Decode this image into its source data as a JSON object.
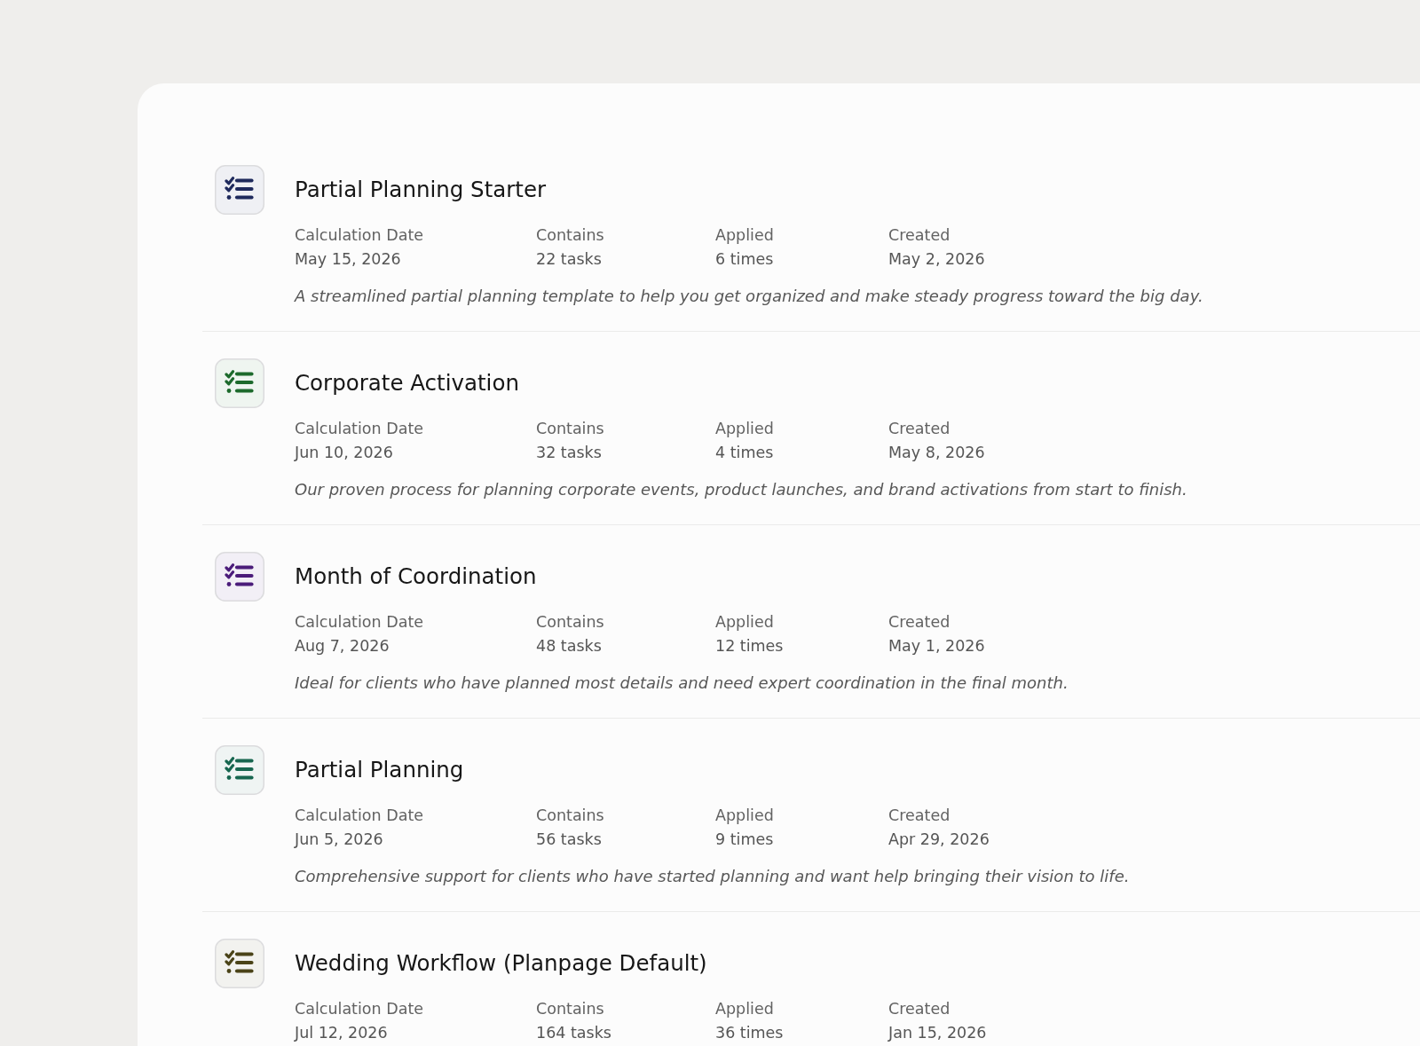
{
  "templates": [
    {
      "title": "Partial Planning Starter",
      "color": "#1f2a5c",
      "fields": [
        {
          "label": "Calculation Date",
          "value": "May 15, 2026"
        },
        {
          "label": "Contains",
          "value": "22 tasks"
        },
        {
          "label": "Applied",
          "value": "6 times"
        },
        {
          "label": "Created",
          "value": "May 2, 2026"
        }
      ],
      "description": "A streamlined partial planning template to help you get organized and make steady progress toward the big day."
    },
    {
      "title": "Corporate Activation",
      "color": "#1d6a2c",
      "fields": [
        {
          "label": "Calculation Date",
          "value": "Jun 10, 2026"
        },
        {
          "label": "Contains",
          "value": "32 tasks"
        },
        {
          "label": "Applied",
          "value": "4 times"
        },
        {
          "label": "Created",
          "value": "May 8, 2026"
        }
      ],
      "description": "Our proven process for planning corporate events, product launches, and brand activations from start to finish."
    },
    {
      "title": "Month of Coordination",
      "color": "#4b1c7a",
      "fields": [
        {
          "label": "Calculation Date",
          "value": "Aug 7, 2026"
        },
        {
          "label": "Contains",
          "value": "48 tasks"
        },
        {
          "label": "Applied",
          "value": "12 times"
        },
        {
          "label": "Created",
          "value": "May 1, 2026"
        }
      ],
      "description": "Ideal for clients who have planned most details and need expert coordination in the final month."
    },
    {
      "title": "Partial Planning",
      "color": "#17664f",
      "fields": [
        {
          "label": "Calculation Date",
          "value": "Jun 5, 2026"
        },
        {
          "label": "Contains",
          "value": "56 tasks"
        },
        {
          "label": "Applied",
          "value": "9 times"
        },
        {
          "label": "Created",
          "value": "Apr 29, 2026"
        }
      ],
      "description": "Comprehensive support for clients who have started planning and want help bringing their vision to life."
    },
    {
      "title": "Wedding Workflow (Planpage Default)",
      "color": "#4a4318",
      "fields": [
        {
          "label": "Calculation Date",
          "value": "Jul 12, 2026"
        },
        {
          "label": "Contains",
          "value": "164 tasks"
        },
        {
          "label": "Applied",
          "value": "36 times"
        },
        {
          "label": "Created",
          "value": "Jan 15, 2026"
        }
      ]
    }
  ]
}
